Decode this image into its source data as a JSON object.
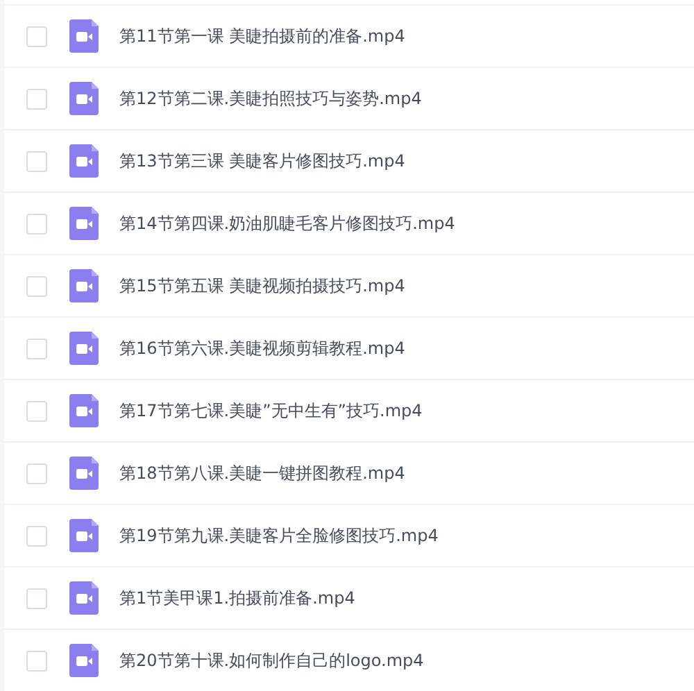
{
  "files": [
    {
      "name": "第11节第一课 美睫拍摄前的准备.mp4",
      "checked": false
    },
    {
      "name": "第12节第二课.美睫拍照技巧与姿势.mp4",
      "checked": false
    },
    {
      "name": "第13节第三课 美睫客片修图技巧.mp4",
      "checked": false
    },
    {
      "name": "第14节第四课.奶油肌睫毛客片修图技巧.mp4",
      "checked": false
    },
    {
      "name": "第15节第五课 美睫视频拍摄技巧.mp4",
      "checked": false
    },
    {
      "name": "第16节第六课.美睫视频剪辑教程.mp4",
      "checked": false
    },
    {
      "name": "第17节第七课.美睫”无中生有”技巧.mp4",
      "checked": false
    },
    {
      "name": "第18节第八课.美睫一键拼图教程.mp4",
      "checked": false
    },
    {
      "name": "第19节第九课.美睫客片全脸修图技巧.mp4",
      "checked": false
    },
    {
      "name": "第1节美甲课1.拍摄前准备.mp4",
      "checked": false
    },
    {
      "name": "第20节第十课.如何制作自己的logo.mp4",
      "checked": false
    }
  ]
}
